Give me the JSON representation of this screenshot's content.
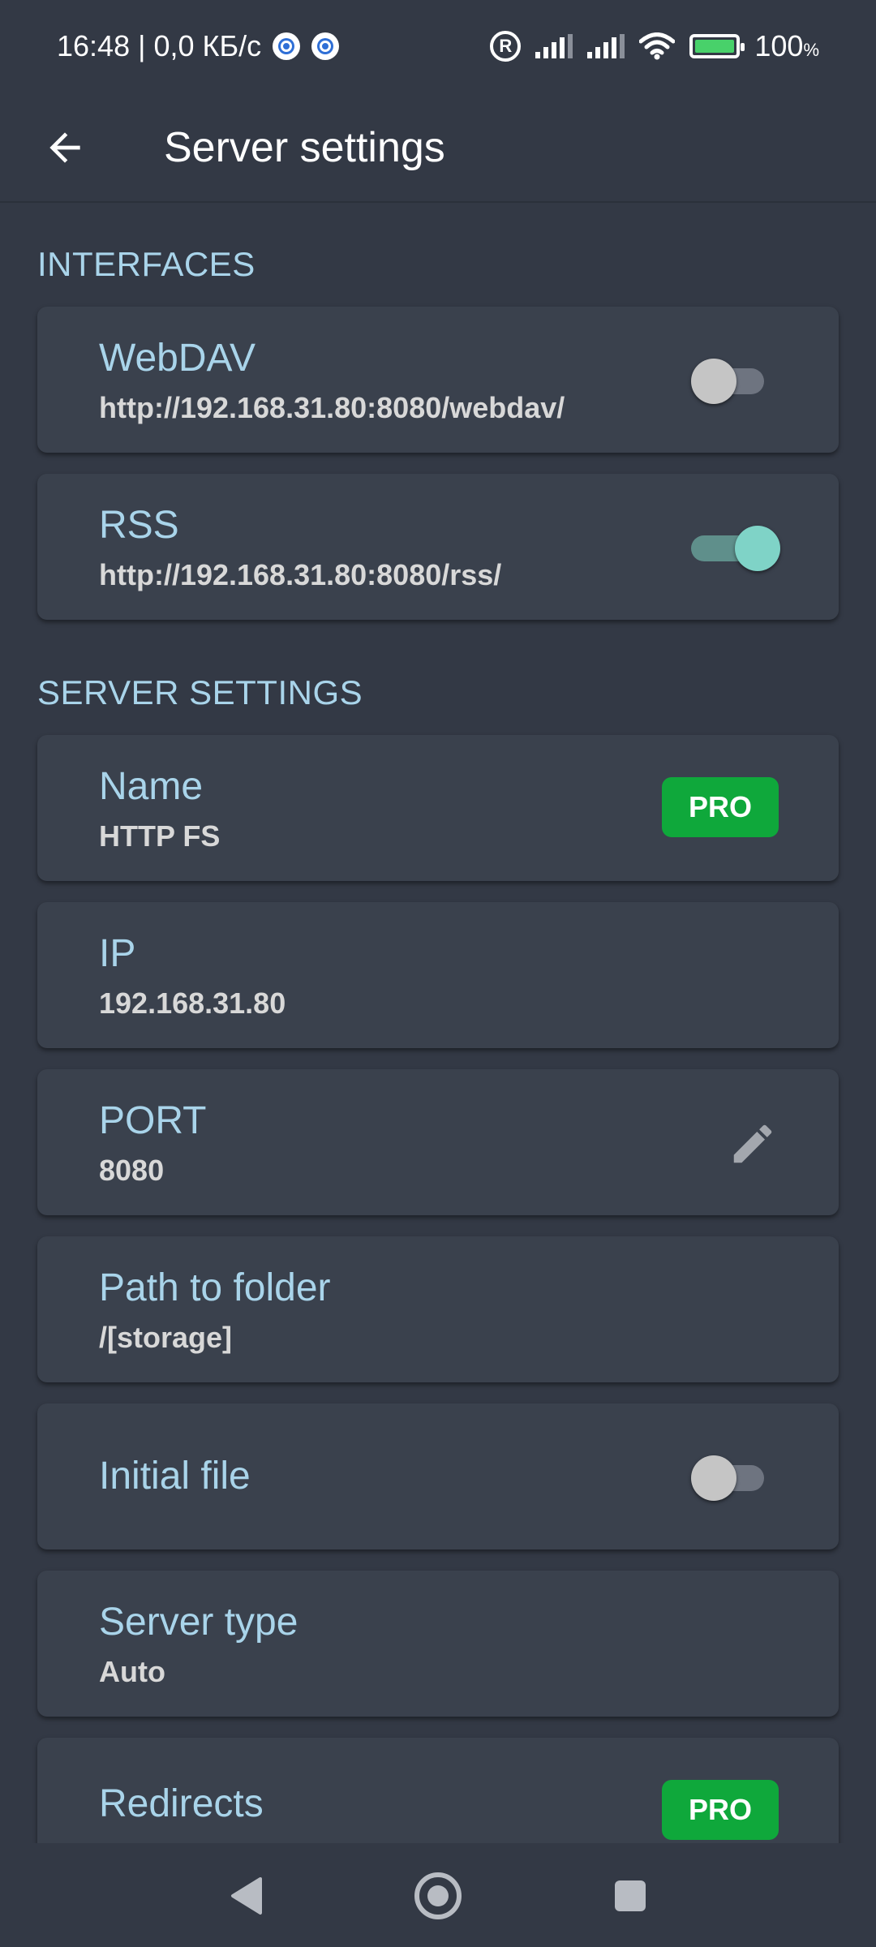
{
  "status_bar": {
    "time_speed": "16:48 | 0,0 КБ/с",
    "registered_symbol": "R",
    "battery_percent": "100",
    "battery_percent_sign": "%",
    "icons": [
      "gear-dot-icon",
      "gear-dot-icon",
      "registered-icon",
      "signal-icon",
      "signal-icon",
      "wifi-icon",
      "battery-charging-icon"
    ]
  },
  "app_bar": {
    "title": "Server settings",
    "back_icon": "arrow-left-icon"
  },
  "sections": {
    "interfaces": {
      "header": "INTERFACES",
      "webdav": {
        "title": "WebDAV",
        "value": "http://192.168.31.80:8080/webdav/",
        "enabled": false
      },
      "rss": {
        "title": "RSS",
        "value": "http://192.168.31.80:8080/rss/",
        "enabled": true
      }
    },
    "server": {
      "header": "SERVER SETTINGS",
      "name": {
        "title": "Name",
        "value": "HTTP FS",
        "badge": "PRO"
      },
      "ip": {
        "title": "IP",
        "value": "192.168.31.80"
      },
      "port": {
        "title": "PORT",
        "value": "8080",
        "action_icon": "pencil-icon"
      },
      "path": {
        "title": "Path to folder",
        "value": "/[storage]"
      },
      "initial_file": {
        "title": "Initial file",
        "enabled": false
      },
      "server_type": {
        "title": "Server type",
        "value": "Auto"
      },
      "redirects": {
        "title": "Redirects",
        "badge": "PRO"
      }
    }
  },
  "nav_bar": {
    "buttons": [
      "back-triangle-icon",
      "home-circle-icon",
      "recents-square-icon"
    ]
  },
  "colors": {
    "background": "#333945",
    "card": "#3a414d",
    "accent_text": "#a9d4ea",
    "pro_badge": "#0fa83b",
    "toggle_on": "#7fd3c7"
  }
}
